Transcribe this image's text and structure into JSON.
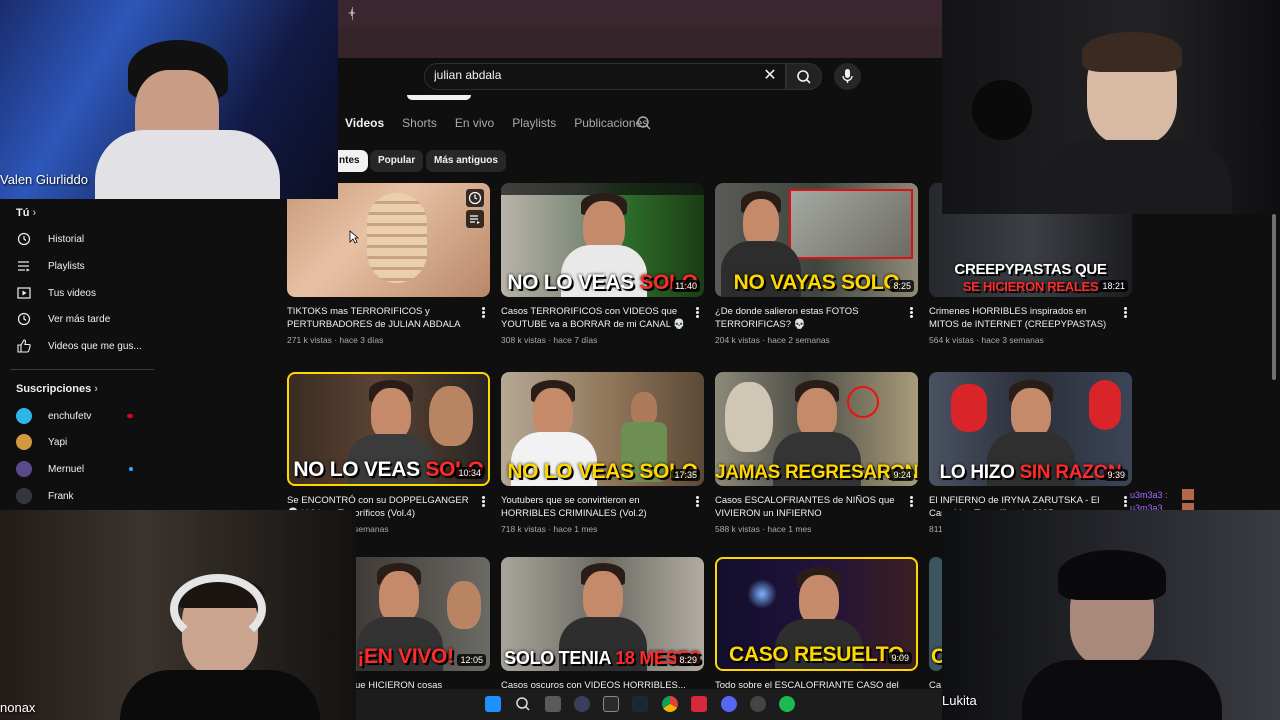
{
  "search": {
    "query": "julian abdala"
  },
  "tabs": [
    {
      "label": "Videos",
      "active": true
    },
    {
      "label": "Shorts"
    },
    {
      "label": "En vivo"
    },
    {
      "label": "Playlists"
    },
    {
      "label": "Publicaciones"
    }
  ],
  "chips": [
    {
      "label": "ntes",
      "active": true
    },
    {
      "label": "Popular"
    },
    {
      "label": "Más antiguos"
    }
  ],
  "sidebar": {
    "you_heading": "Tú",
    "items": [
      {
        "label": "Historial",
        "icon": "history-icon"
      },
      {
        "label": "Playlists",
        "icon": "playlists-icon"
      },
      {
        "label": "Tus videos",
        "icon": "your-videos-icon"
      },
      {
        "label": "Ver más tarde",
        "icon": "watch-later-icon"
      },
      {
        "label": "Videos que me gus...",
        "icon": "thumbs-up-icon"
      }
    ],
    "subs_heading": "Suscripciones",
    "subscriptions": [
      {
        "name": "enchufetv",
        "color": "#2fb5e8",
        "dot": "#d4001e"
      },
      {
        "name": "Yapi",
        "color": "#d29a3e"
      },
      {
        "name": "Mernuel",
        "color": "#5a4a8a",
        "dot": "#3ea6ff"
      },
      {
        "name": "Frank",
        "color": "#33363c"
      }
    ]
  },
  "videos": [
    {
      "title": "TIKTOKS mas TERRORIFICOS y PERTURBADORES de JULIAN ABDALA del...",
      "meta": "271 k vistas · hace 3 días",
      "thumb_text": "",
      "duration": ""
    },
    {
      "title": "Casos TERRORIFICOS con VIDEOS que YOUTUBE va a BORRAR de mi CANAL 💀",
      "meta": "308 k vistas · hace 7 días",
      "thumb_text_a": "NO LO VEAS ",
      "thumb_text_b": "SOLO",
      "duration": "11:40"
    },
    {
      "title": "¿De donde salieron estas FOTOS TERRORIFICAS? 💀",
      "meta": "204 k vistas · hace 2 semanas",
      "thumb_text_a": "NO VAYAS SOLO",
      "thumb_text_b": "",
      "duration": "8:25"
    },
    {
      "title": "Crimenes HORRIBLES inspirados en MITOS de INTERNET (CREEPYPASTAS)",
      "meta": "564 k vistas · hace 3 semanas",
      "thumb_text_a": "CREEPYPASTAS QUE",
      "thumb_text_b": "SE HICIERON REALES",
      "duration": "18:21"
    },
    {
      "title": "Se ENCONTRÓ con su DOPPELGANGER 💀 | Videos Terroríficos (Vol.4)",
      "meta": "4 semanas",
      "thumb_text_a": "NO LO VEAS ",
      "thumb_text_b": "SOLO",
      "duration": "10:34"
    },
    {
      "title": "Youtubers que se convirtieron en HORRIBLES CRIMINALES (Vol.2)",
      "meta": "718 k vistas · hace 1 mes",
      "thumb_text_a": "NO LO VEAS SOLO",
      "thumb_text_b": "",
      "duration": "17:35"
    },
    {
      "title": "Casos ESCALOFRIANTES de NIÑOS que VIVIERON un INFIERNO",
      "meta": "588 k vistas · hace 1 mes",
      "thumb_text_a": "JAMAS REGRESARON",
      "thumb_text_b": "",
      "duration": "9:24"
    },
    {
      "title": "El INFIERNO de IRYNA ZARUTSKA - El Caso Mas Terrorífico de 2025",
      "meta": "811",
      "thumb_text_a": "LO HIZO ",
      "thumb_text_b": "SIN RAZON",
      "duration": "9:39"
    },
    {
      "title": "ue HICIERON cosas",
      "meta": "",
      "thumb_text_a": "ZO ",
      "thumb_text_b": "¡EN VIVO!",
      "duration": "12:05"
    },
    {
      "title": "Casos oscuros con VIDEOS HORRIBLES...",
      "meta": "",
      "thumb_text_a": "SOLO TENIA ",
      "thumb_text_b": "18 MESES",
      "duration": "8:29"
    },
    {
      "title": "Todo sobre el ESCALOFRIANTE CASO del",
      "meta": "",
      "thumb_text_a": "CASO RESUELTO",
      "thumb_text_b": "",
      "duration": "9:09"
    },
    {
      "title": "Ca",
      "meta": "",
      "thumb_text_a": "C",
      "thumb_text_b": "",
      "duration": ""
    }
  ],
  "webcams": {
    "top_left": "Valen Giurliddo",
    "bottom_left": "nonax",
    "bottom_right": "Lukita"
  },
  "chat": [
    "u3m3a3 :",
    "u3m3a3"
  ]
}
